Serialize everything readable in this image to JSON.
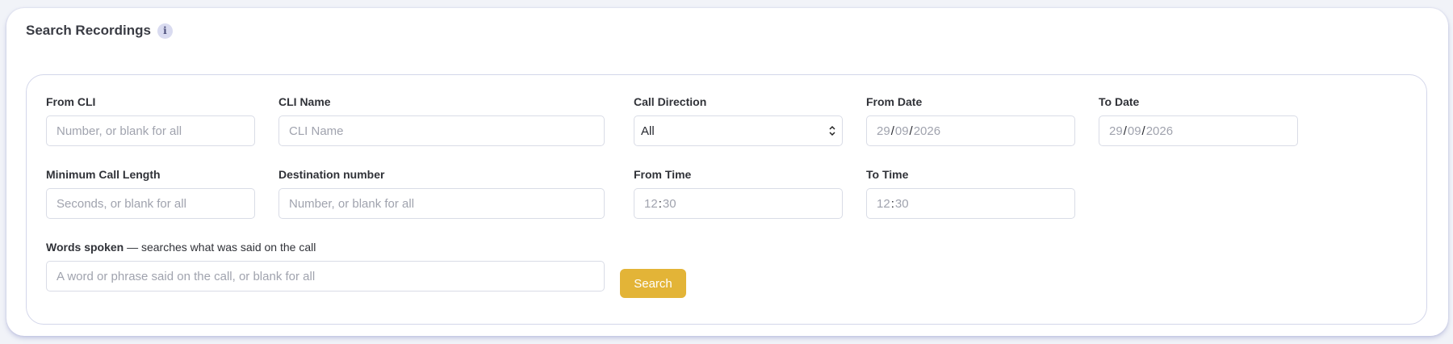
{
  "header": {
    "title": "Search Recordings",
    "info_glyph": "i"
  },
  "fields": {
    "from_cli": {
      "label": "From CLI",
      "placeholder": "Number, or blank for all"
    },
    "cli_name": {
      "label": "CLI Name",
      "placeholder": "CLI Name"
    },
    "call_direction": {
      "label": "Call Direction",
      "value": "All"
    },
    "from_date": {
      "label": "From Date",
      "day": "29",
      "month": "09",
      "year": "2026",
      "sep": "/"
    },
    "to_date": {
      "label": "To Date",
      "day": "29",
      "month": "09",
      "year": "2026",
      "sep": "/"
    },
    "min_call_length": {
      "label": "Minimum Call Length",
      "placeholder": "Seconds, or blank for all"
    },
    "destination_number": {
      "label": "Destination number",
      "placeholder": "Number, or blank for all"
    },
    "from_time": {
      "label": "From Time",
      "hour": "12",
      "minute": "30",
      "sep": ":"
    },
    "to_time": {
      "label": "To Time",
      "hour": "12",
      "minute": "30",
      "sep": ":"
    },
    "words_spoken": {
      "label": "Words spoken",
      "hint": " — searches what was said on the call",
      "placeholder": "A word or phrase said on the call, or blank for all"
    }
  },
  "actions": {
    "search_label": "Search"
  },
  "colors": {
    "accent": "#e3b437",
    "panel_border": "#d3d6ea",
    "info_bg": "#d9dbf0"
  }
}
